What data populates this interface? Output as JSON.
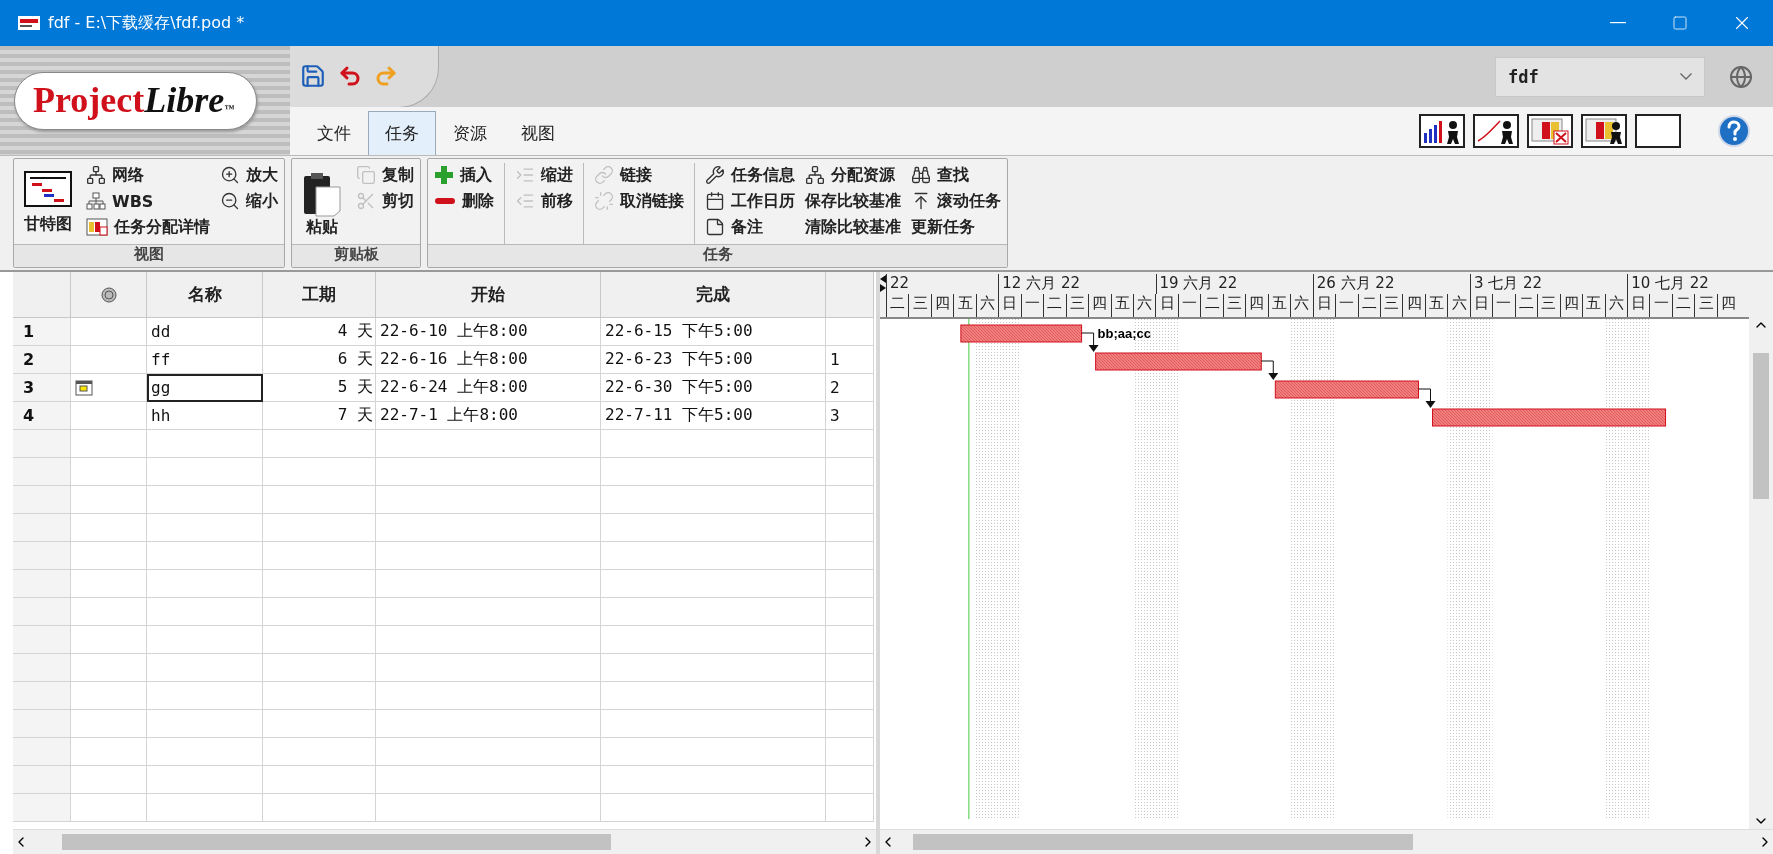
{
  "window": {
    "title": "fdf - E:\\下载缓存\\fdf.pod *"
  },
  "logo": {
    "first": "Project",
    "second": "Libre",
    "mark": "™"
  },
  "tabs": [
    {
      "label": "文件",
      "selected": false
    },
    {
      "label": "任务",
      "selected": true
    },
    {
      "label": "资源",
      "selected": false
    },
    {
      "label": "视图",
      "selected": false
    }
  ],
  "project_select": {
    "value": "fdf"
  },
  "ribbon": {
    "groups": [
      {
        "label": "视图",
        "columns": [
          {
            "divider": false,
            "items": [
              {
                "label": "甘特图",
                "kind": "large",
                "disabled": false
              }
            ]
          },
          {
            "divider": false,
            "items": [
              {
                "label": "网络",
                "kind": "small",
                "disabled": false
              },
              {
                "label": "WBS",
                "kind": "small",
                "disabled": false
              },
              {
                "label": "任务分配详情",
                "kind": "small",
                "disabled": false
              }
            ]
          },
          {
            "divider": false,
            "items": [
              {
                "label": "放大",
                "kind": "small",
                "disabled": false
              },
              {
                "label": "缩小",
                "kind": "small",
                "disabled": false
              }
            ]
          }
        ]
      },
      {
        "label": "剪贴板",
        "columns": [
          {
            "divider": false,
            "items": [
              {
                "label": "粘贴",
                "kind": "large",
                "disabled": false
              }
            ]
          },
          {
            "divider": false,
            "items": [
              {
                "label": "复制",
                "kind": "small",
                "disabled": true
              },
              {
                "label": "剪切",
                "kind": "small",
                "disabled": true
              }
            ]
          }
        ]
      },
      {
        "label": "任务",
        "columns": [
          {
            "divider": false,
            "items": [
              {
                "label": "插入",
                "kind": "small",
                "disabled": false
              },
              {
                "label": "删除",
                "kind": "small",
                "disabled": false
              }
            ]
          },
          {
            "divider": true,
            "items": [
              {
                "label": "缩进",
                "kind": "small",
                "disabled": true
              },
              {
                "label": "前移",
                "kind": "small",
                "disabled": true
              }
            ]
          },
          {
            "divider": true,
            "items": [
              {
                "label": "链接",
                "kind": "small",
                "disabled": true
              },
              {
                "label": "取消链接",
                "kind": "small",
                "disabled": true
              }
            ]
          },
          {
            "divider": true,
            "items": [
              {
                "label": "任务信息",
                "kind": "small",
                "disabled": false
              },
              {
                "label": "工作日历",
                "kind": "small",
                "disabled": false
              },
              {
                "label": "备注",
                "kind": "small",
                "disabled": false
              }
            ]
          },
          {
            "divider": false,
            "items": [
              {
                "label": "分配资源",
                "kind": "small",
                "disabled": false
              },
              {
                "label": "保存比较基准",
                "kind": "text",
                "disabled": false
              },
              {
                "label": "清除比较基准",
                "kind": "text",
                "disabled": false
              }
            ]
          },
          {
            "divider": false,
            "items": [
              {
                "label": "查找",
                "kind": "small",
                "disabled": false
              },
              {
                "label": "滚动任务",
                "kind": "small",
                "disabled": false
              },
              {
                "label": "更新任务",
                "kind": "text",
                "disabled": false
              }
            ]
          }
        ]
      }
    ]
  },
  "table": {
    "columns": [
      "名称",
      "工期",
      "开始",
      "完成"
    ],
    "rows": [
      {
        "id": "1",
        "calendar": false,
        "name": "dd",
        "duration": "4 天",
        "start": "22-6-10  上午8:00",
        "finish": "22-6-15  下午5:00",
        "predecessors": "",
        "selected": false,
        "resources": "bb;aa;cc"
      },
      {
        "id": "2",
        "calendar": false,
        "name": "ff",
        "duration": "6 天",
        "start": "22-6-16  上午8:00",
        "finish": "22-6-23  下午5:00",
        "predecessors": "1",
        "selected": false,
        "resources": ""
      },
      {
        "id": "3",
        "calendar": true,
        "name": "gg",
        "duration": "5 天",
        "start": "22-6-24  上午8:00",
        "finish": "22-6-30  下午5:00",
        "predecessors": "2",
        "selected": true,
        "resources": ""
      },
      {
        "id": "4",
        "calendar": false,
        "name": "hh",
        "duration": "7 天",
        "start": "22-7-1  上午8:00",
        "finish": "22-7-11  下午5:00",
        "predecessors": "3",
        "selected": false,
        "resources": ""
      }
    ]
  },
  "gantt": {
    "weeks": [
      {
        "label": "22",
        "kind": "partial"
      },
      {
        "label": "12  六月  22",
        "kind": "full"
      },
      {
        "label": "19  六月  22",
        "kind": "full"
      },
      {
        "label": "26  六月  22",
        "kind": "full"
      },
      {
        "label": "3  七月  22",
        "kind": "full"
      },
      {
        "label": "10  七月  22",
        "kind": "full"
      }
    ],
    "days": [
      "二",
      "三",
      "四",
      "五",
      "六",
      "日",
      "一",
      "二",
      "三",
      "四",
      "五",
      "六",
      "日",
      "一",
      "二",
      "三",
      "四",
      "五",
      "六",
      "日",
      "一",
      "二",
      "三",
      "四",
      "五",
      "六",
      "日",
      "一",
      "二",
      "三",
      "四",
      "五",
      "六",
      "日",
      "一",
      "二",
      "三",
      "四"
    ]
  }
}
